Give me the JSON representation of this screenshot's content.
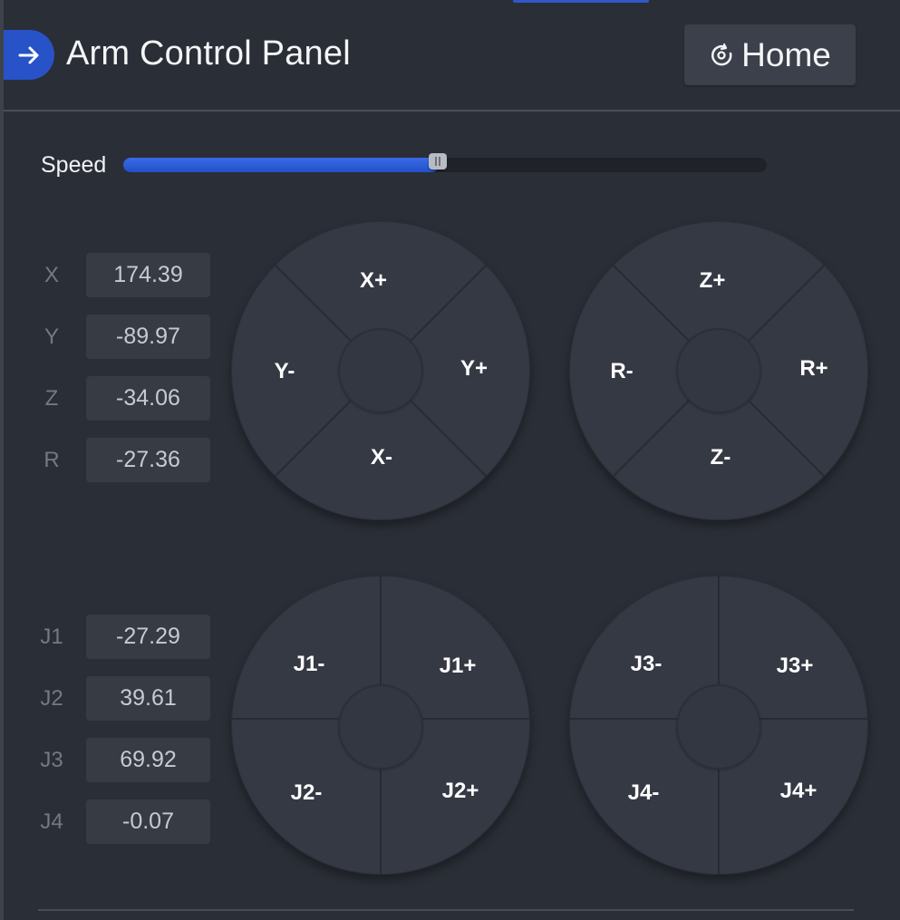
{
  "header": {
    "title": "Arm Control Panel",
    "home_label": "Home",
    "nav_icon": "arrow-right-icon",
    "home_icon": "home-target-icon"
  },
  "speed": {
    "label": "Speed",
    "value_fraction": 0.49
  },
  "cartesian": [
    {
      "label": "X",
      "value": "174.39"
    },
    {
      "label": "Y",
      "value": "-89.97"
    },
    {
      "label": "Z",
      "value": "-34.06"
    },
    {
      "label": "R",
      "value": "-27.36"
    }
  ],
  "joints": [
    {
      "label": "J1",
      "value": "-27.29"
    },
    {
      "label": "J2",
      "value": "39.61"
    },
    {
      "label": "J3",
      "value": "69.92"
    },
    {
      "label": "J4",
      "value": "-0.07"
    }
  ],
  "pads": {
    "xy": {
      "up": "X+",
      "down": "X-",
      "left": "Y-",
      "right": "Y+"
    },
    "zr": {
      "up": "Z+",
      "down": "Z-",
      "left": "R-",
      "right": "R+"
    },
    "j12": {
      "tl": "J1-",
      "tr": "J1+",
      "bl": "J2-",
      "br": "J2+"
    },
    "j34": {
      "tl": "J3-",
      "tr": "J3+",
      "bl": "J4-",
      "br": "J4+"
    }
  },
  "colors": {
    "accent": "#2752c8",
    "background": "#2a2e36",
    "pad": "#353944",
    "value_box": "#363b44"
  }
}
